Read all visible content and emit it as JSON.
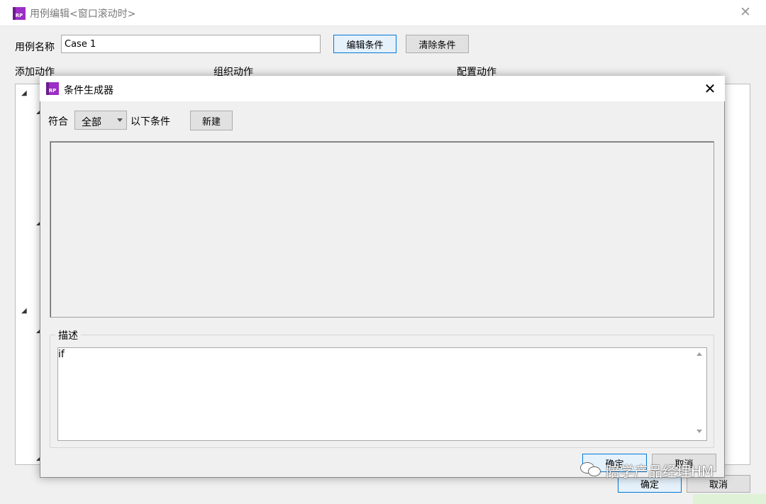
{
  "outer_dialog": {
    "title": "用例编辑<窗口滚动时>",
    "case_name_label": "用例名称",
    "case_name_value": "Case 1",
    "edit_conditions_button": "编辑条件",
    "clear_conditions_button": "清除条件",
    "columns": {
      "add_action": "添加动作",
      "organize_action": "组织动作",
      "configure_action": "配置动作"
    },
    "ok_button": "确定",
    "cancel_button": "取消"
  },
  "condition_builder": {
    "title": "条件生成器",
    "match_label": "符合",
    "match_selected": "全部",
    "match_suffix": "以下条件",
    "new_button": "新建",
    "description_legend": "描述",
    "description_text": "if",
    "ok_button": "确定",
    "cancel_button": "取消"
  },
  "watermark": {
    "text": "陪学产品经理HM",
    "icon": "wechat-icon"
  },
  "icons": {
    "app_logo": "axure-rp-logo-icon",
    "close": "close-icon",
    "tree_expander": "triangle-expanded-icon",
    "dropdown": "chevron-down-icon"
  },
  "colors": {
    "app_logo": "#9b2ec4",
    "primary_button_border": "#0078d7",
    "primary_button_bg": "#e5f1fb",
    "dialog_bg": "#f0f0f0"
  }
}
